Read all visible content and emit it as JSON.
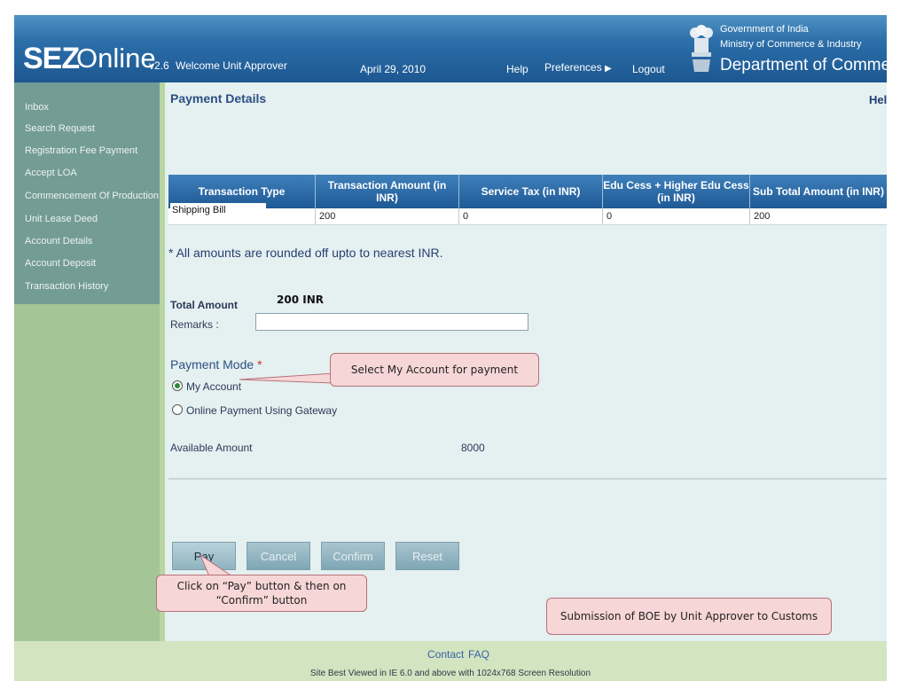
{
  "header": {
    "logo_sez": "SEZ",
    "logo_online": "Online",
    "version": "v2.6",
    "welcome": "Welcome Unit Approver",
    "date": "April 29, 2010",
    "help": "Help",
    "preferences": "Preferences",
    "logout": "Logout",
    "gov_line1": "Government of India",
    "gov_line2": "Ministry of Commerce & Industry",
    "gov_line3": "Department of Commerce",
    "colors": {
      "header_blue": "#2b6ea8"
    }
  },
  "sidebar": {
    "items": [
      {
        "label": "Inbox"
      },
      {
        "label": "Search Request"
      },
      {
        "label": "Registration Fee Payment"
      },
      {
        "label": "Accept LOA"
      },
      {
        "label": "Commencement Of Production"
      },
      {
        "label": "Unit Lease Deed"
      },
      {
        "label": "Account Details"
      },
      {
        "label": "Account Deposit"
      },
      {
        "label": "Transaction History"
      }
    ]
  },
  "main": {
    "title": "Payment Details",
    "help": "Hel",
    "table": {
      "headers": [
        "Transaction Type",
        "Transaction Amount (in INR)",
        "Service Tax (in INR)",
        "Edu Cess + Higher Edu Cess (in INR)",
        "Sub Total Amount (in INR)"
      ],
      "row": [
        "Shipping Bill",
        "200",
        "0",
        "0",
        "200"
      ]
    },
    "note": "* All amounts are rounded off upto to nearest INR.",
    "total_label": "Total Amount",
    "total_value": "200 INR",
    "remarks_label": "Remarks :",
    "remarks_value": "",
    "payment_mode_label": "Payment Mode",
    "required_star": "*",
    "options": [
      {
        "label": "My Account",
        "selected": true
      },
      {
        "label": "Online Payment Using Gateway",
        "selected": false
      }
    ],
    "available_label": "Available Amount",
    "available_value": "8000",
    "buttons": {
      "pay": "Pay",
      "cancel": "Cancel",
      "confirm": "Confirm",
      "reset": "Reset"
    }
  },
  "callouts": {
    "select_account": "Select My Account  for payment",
    "click_pay": "Click  on “Pay” button & then on “Confirm” button",
    "submission": "Submission of BOE by Unit Approver to Customs"
  },
  "footer": {
    "contact": "Contact",
    "faq": "FAQ",
    "note": "Site Best Viewed in IE 6.0 and above with 1024x768 Screen Resolution"
  }
}
